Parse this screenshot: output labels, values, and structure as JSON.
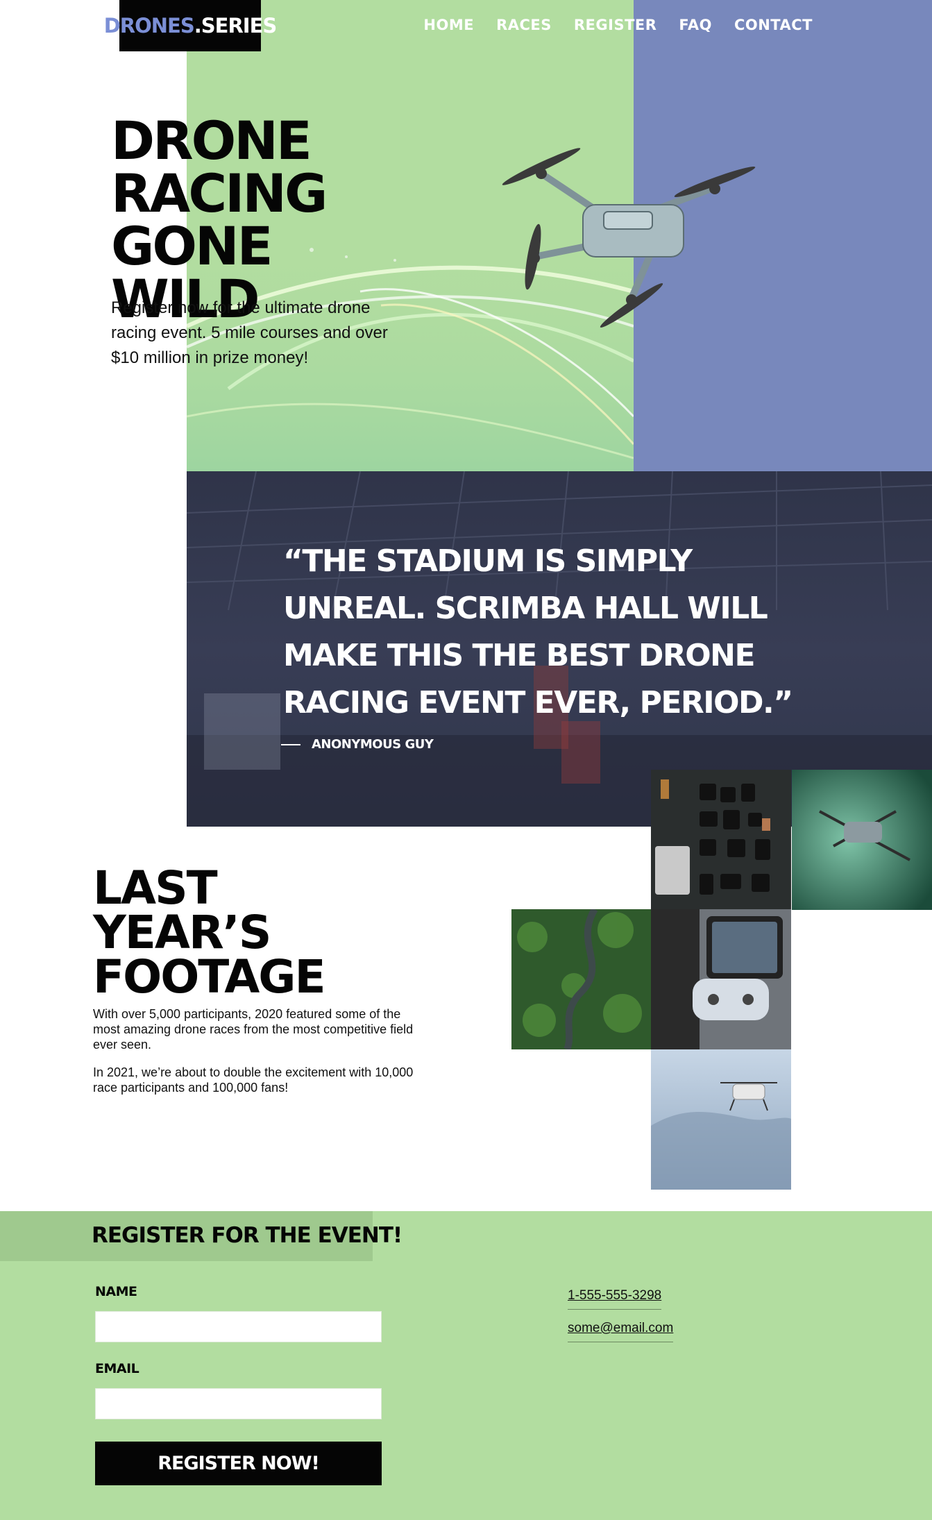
{
  "header": {
    "logo_part1": "DRONES",
    "logo_part2": ".SERIES",
    "nav": [
      "HOME",
      "RACES",
      "REGISTER",
      "FAQ",
      "CONTACT"
    ]
  },
  "hero": {
    "title_line1": "DRONE",
    "title_line2": "RACING GONE",
    "title_line3": "WILD",
    "text": "Register now for the ultimate drone racing event. 5 mile courses and over $10 million in prize money!"
  },
  "quote": {
    "text": "“THE STADIUM IS SIMPLY UNREAL. SCRIMBA HALL WILL MAKE THIS THE BEST DRONE RACING EVENT EVER, PERIOD.”",
    "author": "ANONYMOUS GUY"
  },
  "footage": {
    "title_line1": "LAST YEAR’S",
    "title_line2": "FOOTAGE",
    "para1": "With over 5,000 participants, 2020 featured some of the most amazing drone races from the most competitive field ever seen.",
    "para2": "In 2021, we’re about to double the excitement with 10,000 race participants and 100,000 fans!"
  },
  "register": {
    "title": "REGISTER FOR THE EVENT!",
    "name_label": "NAME",
    "email_label": "EMAIL",
    "name_value": "",
    "email_value": "",
    "button": "REGISTER NOW!",
    "phone": "1-555-555-3298",
    "email_contact": "some@email.com"
  },
  "colors": {
    "green": "#b2dda0",
    "blue": "#7888bc",
    "dark": "#2f3449",
    "logo_accent": "#7b8fd6"
  }
}
